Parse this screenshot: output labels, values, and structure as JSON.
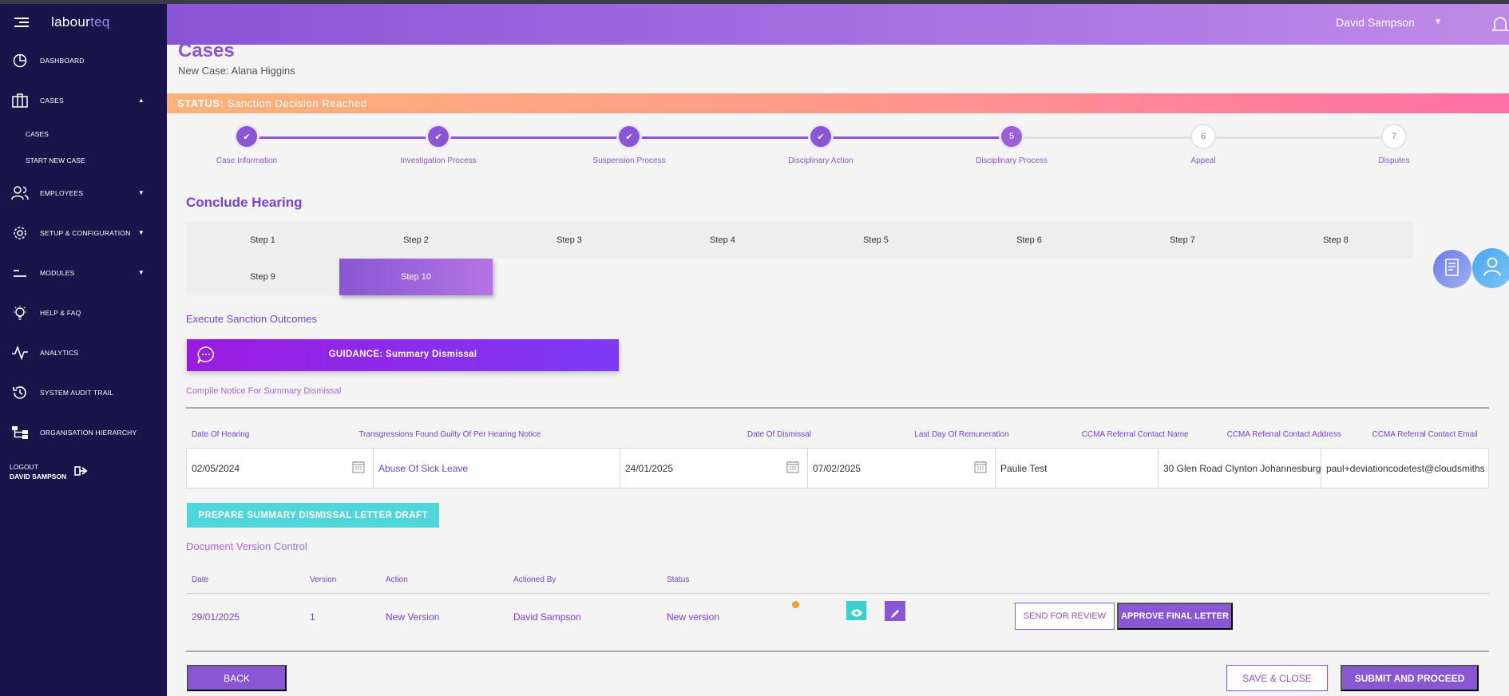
{
  "app": {
    "logo_main": "labour",
    "logo_accent": "teq"
  },
  "sidebar": {
    "items": [
      {
        "label": "Dashboard",
        "icon": "pie-chart-icon"
      },
      {
        "label": "Cases",
        "icon": "briefcase-icon"
      },
      {
        "label": "Employees",
        "icon": "users-icon"
      },
      {
        "label": "Setup & Configuration",
        "icon": "gear-icon"
      },
      {
        "label": "Modules",
        "icon": "modules-icon"
      },
      {
        "label": "Help & FAQ",
        "icon": "lightbulb-icon"
      },
      {
        "label": "Analytics",
        "icon": "pulse-icon"
      },
      {
        "label": "System Audit Trail",
        "icon": "history-icon"
      },
      {
        "label": "Organisation Hierarchy",
        "icon": "hierarchy-icon"
      }
    ],
    "sub_items": [
      "Cases",
      "Start New Case"
    ],
    "logout_label": "Logout",
    "logout_user": "David Sampson"
  },
  "header": {
    "user_name": "David Sampson"
  },
  "page": {
    "title": "Cases",
    "subtitle": "New Case: Alana Higgins",
    "status_label": "STATUS:",
    "status_value": "Sanction Decision Reached"
  },
  "progress": {
    "steps": [
      {
        "num": "",
        "label": "Case Information",
        "state": "done"
      },
      {
        "num": "",
        "label": "Investigation Process",
        "state": "done"
      },
      {
        "num": "",
        "label": "Suspension Process",
        "state": "done"
      },
      {
        "num": "",
        "label": "Disciplinary Action",
        "state": "done"
      },
      {
        "num": "5",
        "label": "Disciplinary Process",
        "state": "current"
      },
      {
        "num": "6",
        "label": "Appeal",
        "state": "todo"
      },
      {
        "num": "7",
        "label": "Disputes",
        "state": "todo"
      }
    ]
  },
  "hearing": {
    "title": "Conclude Hearing",
    "tabs": [
      "Step 1",
      "Step 2",
      "Step 3",
      "Step 4",
      "Step 5",
      "Step 6",
      "Step 7",
      "Step 8",
      "Step 9",
      "Step 10"
    ],
    "active_tab": "Step 10",
    "exec_title": "Execute Sanction Outcomes",
    "guidance": "GUIDANCE: Summary Dismissal",
    "compile_title": "Compile Notice For Summary Dismissal"
  },
  "form": {
    "headers": [
      "Date Of Hearing",
      "Transgressions Found Guilty Of Per Hearing Notice",
      "Date Of Dismissal",
      "Last Day Of Remuneration",
      "CCMA Referral Contact Name",
      "CCMA Referral Contact Address",
      "CCMA Referral Contact Email"
    ],
    "values": [
      "02/05/2024",
      "Abuse Of Sick Leave",
      "24/01/2025",
      "07/02/2025",
      "Paulie Test",
      "30 Glen Road Clynton Johannesburg",
      "paul+deviationcodetest@cloudsmiths"
    ]
  },
  "prepare_label": "PREPARE SUMMARY DISMISSAL LETTER DRAFT",
  "versions": {
    "title": "Document Version Control",
    "headers": [
      "Date",
      "Version",
      "Action",
      "Actioned By",
      "Status"
    ],
    "rows": [
      {
        "date": "29/01/2025",
        "version": "1",
        "action": "New Version",
        "actioned_by": "David Sampson",
        "status": "New version",
        "status_color": "#f7a12a"
      }
    ],
    "send_review_label": "SEND FOR REVIEW",
    "approve_label": "APPROVE FINAL LETTER"
  },
  "footer": {
    "back_label": "BACK",
    "save_label": "SAVE & CLOSE",
    "submit_label": "SUBMIT AND PROCEED"
  },
  "colors": {
    "sidebar": "#19144a",
    "accent": "#8a56d4",
    "teal": "#4fd6db",
    "status_start": "#ffb27a",
    "status_end": "#ff6fa5"
  }
}
